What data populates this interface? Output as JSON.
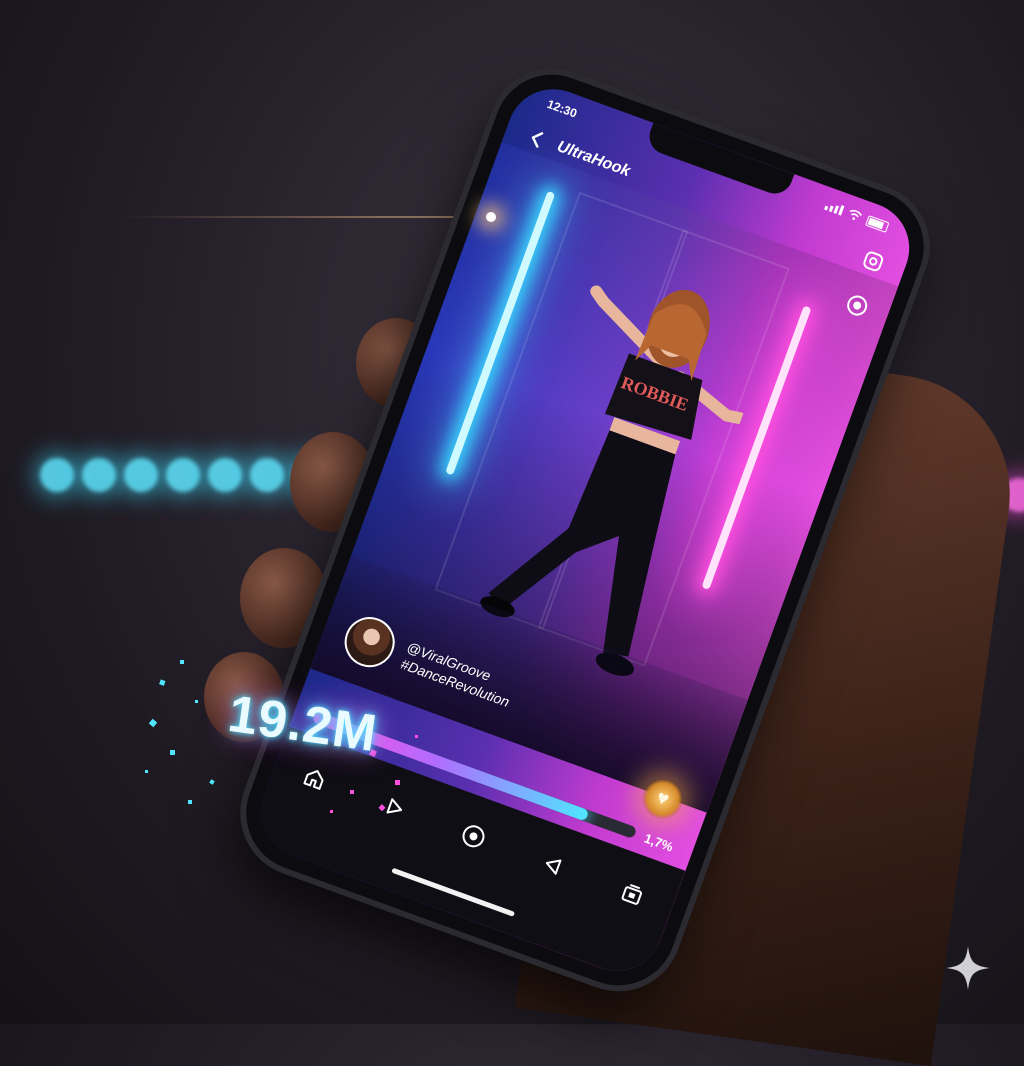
{
  "status_bar": {
    "time": "12:30"
  },
  "header": {
    "title": "UltraHook",
    "back_icon": "chevron-left-icon",
    "search_icon": "search-icon",
    "record_icon": "record-icon"
  },
  "video": {
    "creator_handle": "@ViralGroove",
    "hashtag": "#DanceRevolution",
    "view_count": "19.2M",
    "progress_label": "1,7%",
    "progress_fill": 0.85,
    "like_icon": "heart-icon"
  },
  "bottom_nav": {
    "items": [
      {
        "icon": "home-icon"
      },
      {
        "icon": "play-icon"
      },
      {
        "icon": "record-icon"
      },
      {
        "icon": "back-triangle-icon"
      },
      {
        "icon": "library-icon"
      }
    ]
  },
  "colors": {
    "cyan": "#4fe6ff",
    "magenta": "#ff4fe0",
    "background": "#221d26"
  }
}
